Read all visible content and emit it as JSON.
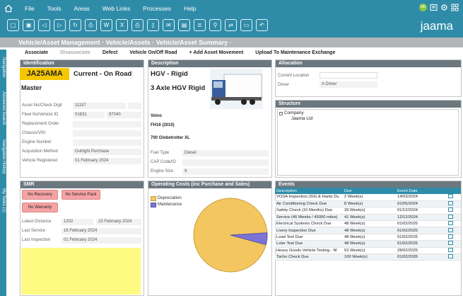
{
  "menu": [
    "File",
    "Tools",
    "Areas",
    "Web Links",
    "Processes",
    "Help"
  ],
  "user_initials": "ME",
  "logo": "jaama",
  "breadcrumb": "Vehicle/Asset Management  ·  Vehicle/Assets  ·  Vehicle/Asset Summary  ·",
  "actions": [
    "Associate",
    "Disassociate",
    "Defect",
    "Vehicle On/Off Road",
    "+ Add Asset Movement",
    "Upload To Maintenance Exchange"
  ],
  "side_tabs": [
    "Navigation",
    "Advanced Search",
    "Navigation History",
    "My Tasks (1)"
  ],
  "identification": {
    "title": "Identification",
    "reg": "JA25AMA",
    "status": "Current - On Road",
    "master": "Master",
    "rows": [
      {
        "label": "Asset No/Check Digit",
        "value": "11197",
        "value2": ""
      },
      {
        "label": "Fleet No/Vehicle ID",
        "value": "01631",
        "value2": "97040"
      },
      {
        "label": "Replacement Order",
        "value": "",
        "value2": ""
      },
      {
        "label": "Chassis/VIN",
        "value": "",
        "value2": ""
      },
      {
        "label": "Engine Number",
        "value": "",
        "value2": ""
      },
      {
        "label": "Acquisition Method",
        "value": "Outright Purchase",
        "value2": ""
      },
      {
        "label": "Vehicle Registered",
        "value": "01 February 2024",
        "value2": ""
      }
    ]
  },
  "description": {
    "title": "Description",
    "type": "HGV - Rigid",
    "axle": "3 Axle HGV Rigid",
    "make": "Volvo",
    "model": "FH16 (2010)",
    "variant": "700 Globetrotter XL",
    "rows": [
      {
        "label": "Fuel Type",
        "value": "Diesel"
      },
      {
        "label": "CAP Code/ID",
        "value": ""
      },
      {
        "label": "Engine Size",
        "value": "9"
      }
    ]
  },
  "allocation": {
    "title": "Allocation",
    "rows": [
      {
        "label": "Current Location",
        "value": ""
      },
      {
        "label": "Driver",
        "value": "A Driver"
      }
    ]
  },
  "structure": {
    "title": "Structure",
    "root": "Company",
    "child": "Jaama Ltd"
  },
  "smr": {
    "title": "SMR",
    "badges": [
      "No Recovery",
      "No Service Pack",
      "No Warranty"
    ],
    "rows": [
      {
        "label": "Latest Distance",
        "value": "1202",
        "value2": "23 February 2024"
      },
      {
        "label": "Last Service",
        "value": "16 February 2024",
        "value2": ""
      },
      {
        "label": "Last Inspection",
        "value": "01 February 2024",
        "value2": ""
      }
    ]
  },
  "operating_costs": {
    "title": "Operating Costs (inc Purchase and Sales)",
    "legend": [
      "Depreciation",
      "Maintenance"
    ],
    "colors": {
      "depreciation": "#f3c65f",
      "maintenance": "#7b74d6"
    },
    "maintenance_share": 0.052
  },
  "events": {
    "title": "Events",
    "headers": [
      "Description",
      "Due",
      "Event Date"
    ],
    "rows": [
      [
        "VOSA Inspection (SIG & Hants Du",
        "2 Week(s)",
        "14/03/2024"
      ],
      [
        "Air Conditioning Check Due",
        "8 Week(s)",
        "01/05/2024"
      ],
      [
        "Safety Check (10 Months) Due",
        "39 Week(s)",
        "01/12/2024"
      ],
      [
        "Service (45 Weeks / 45000 miles)",
        "41 Week(s)",
        "12/12/2024"
      ],
      [
        "Electrical Systems Check Due",
        "48 Week(s)",
        "01/02/2025"
      ],
      [
        "Livery Inspection Due",
        "48 Week(s)",
        "01/02/2025"
      ],
      [
        "Load Test Due",
        "48 Week(s)",
        "01/02/2025"
      ],
      [
        "Loler Test Due",
        "48 Week(s)",
        "01/02/2025"
      ],
      [
        "Heavy Goods Vehicle Testing - M",
        "52 Week(s)",
        "28/02/2025"
      ],
      [
        "Tacho Check Due",
        "100 Week(s)",
        "01/02/2026"
      ]
    ]
  }
}
